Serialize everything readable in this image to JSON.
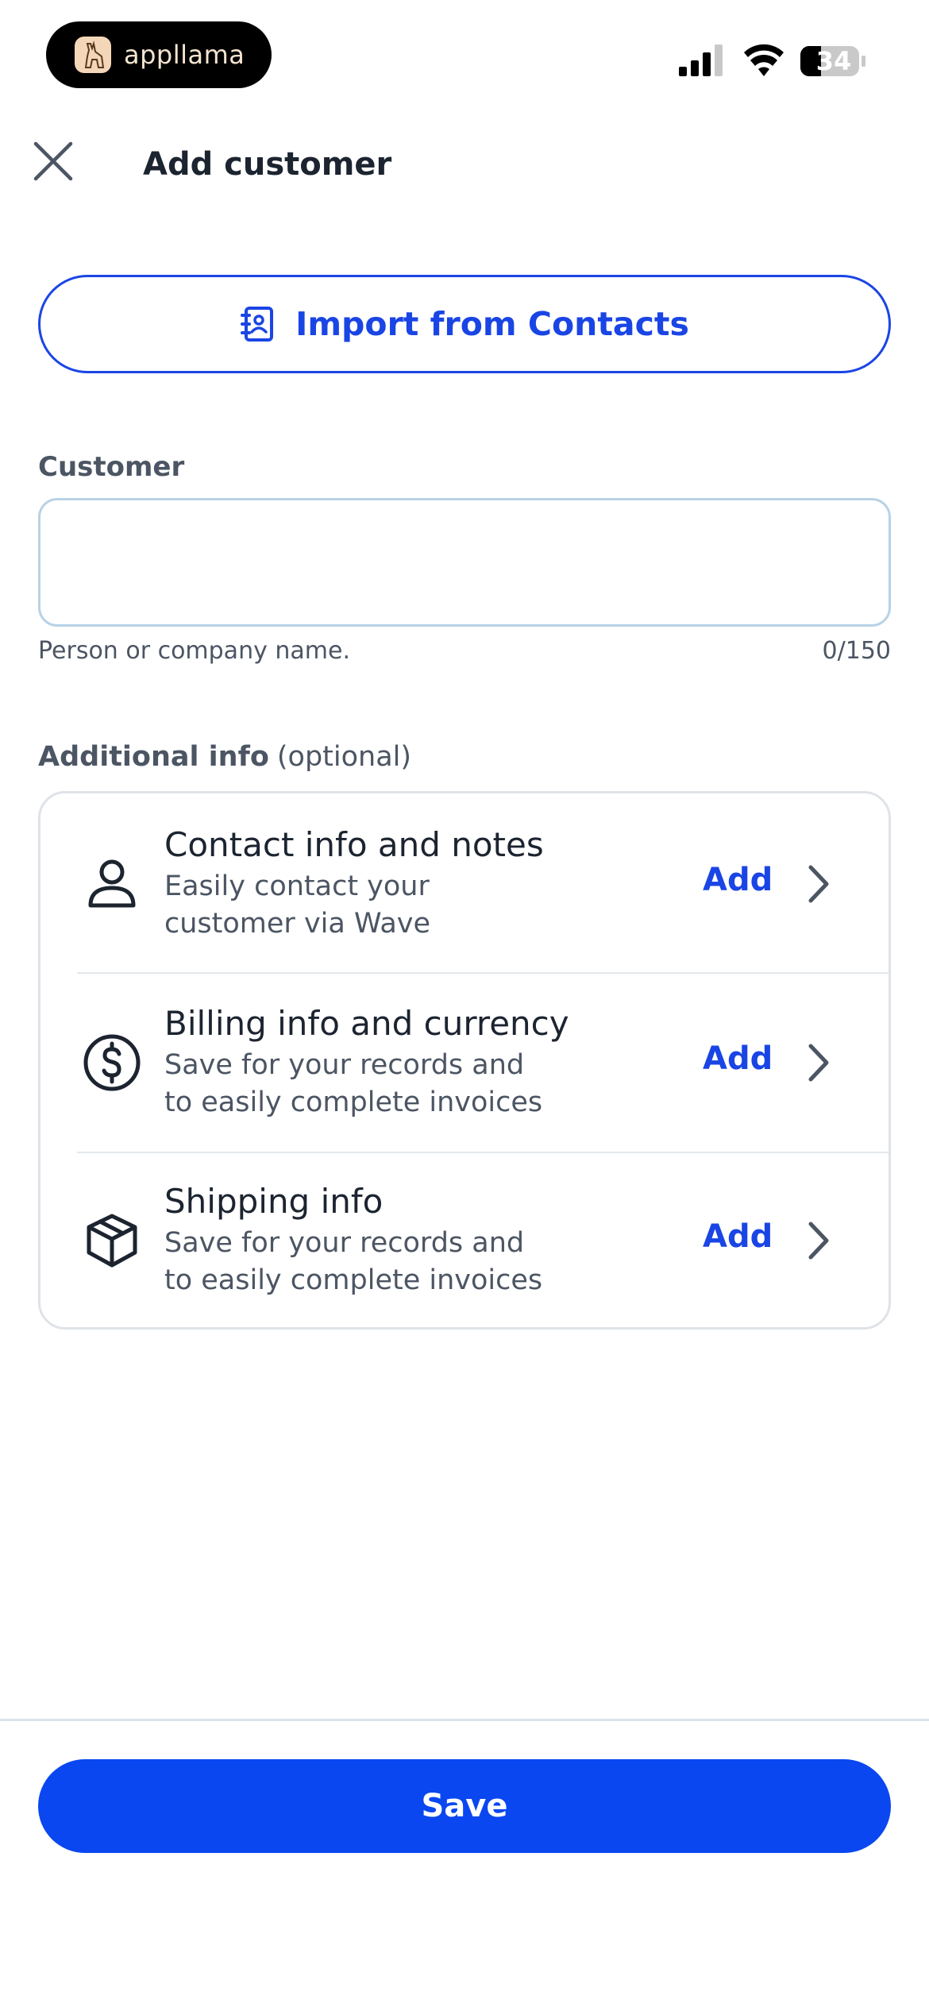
{
  "status_bar": {
    "brand": "appllama",
    "battery": "34",
    "icons": [
      "llama-logo-icon",
      "signal-icon",
      "wifi-icon",
      "battery-icon"
    ]
  },
  "header": {
    "title": "Add customer",
    "close_icon": "close-icon"
  },
  "import_button": {
    "label": "Import from Contacts",
    "icon": "contacts-book-icon"
  },
  "customer_field": {
    "label": "Customer",
    "value": "",
    "placeholder": "",
    "helper": "Person or company name.",
    "counter": "0/150"
  },
  "additional_info": {
    "label": "Additional info",
    "optional": "(optional)",
    "items": [
      {
        "title": "Contact info and notes",
        "subtitle_line1": "Easily contact your",
        "subtitle_line2": "customer via Wave",
        "action": "Add",
        "icon": "person-icon"
      },
      {
        "title": "Billing info and currency",
        "subtitle_line1": "Save for your records and",
        "subtitle_line2": "to easily complete invoices",
        "action": "Add",
        "icon": "dollar-circle-icon"
      },
      {
        "title": "Shipping info",
        "subtitle_line1": "Save for your records and",
        "subtitle_line2": "to easily complete invoices",
        "action": "Add",
        "icon": "package-icon"
      }
    ]
  },
  "footer": {
    "save_label": "Save"
  },
  "colors": {
    "accent": "#1a45e5",
    "save_button": "#0a47f0",
    "text_primary": "#1c2430",
    "text_secondary": "#4c5563",
    "input_border": "#b8d2e6",
    "card_border": "#dfe3e8"
  }
}
